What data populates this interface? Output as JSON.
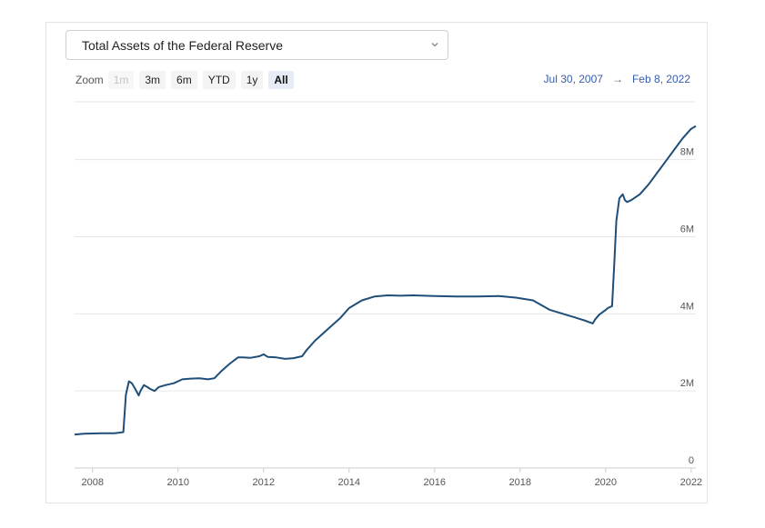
{
  "selector": {
    "label": "Total Assets of the Federal Reserve",
    "icon": "chevron-down-icon"
  },
  "zoom": {
    "label": "Zoom",
    "buttons": [
      {
        "label": "1m",
        "state": "disabled"
      },
      {
        "label": "3m",
        "state": "normal"
      },
      {
        "label": "6m",
        "state": "normal"
      },
      {
        "label": "YTD",
        "state": "normal"
      },
      {
        "label": "1y",
        "state": "normal"
      },
      {
        "label": "All",
        "state": "active"
      }
    ]
  },
  "range": {
    "from": "Jul 30, 2007",
    "arrow": "→",
    "to": "Feb 8, 2022"
  },
  "colors": {
    "line": "#1f4e79",
    "grid": "#e6e6e6",
    "range_text": "#335cad"
  },
  "chart_data": {
    "type": "line",
    "title": "",
    "xlabel": "",
    "ylabel": "",
    "x_ticks": [
      "2008",
      "2010",
      "2012",
      "2014",
      "2016",
      "2018",
      "2020",
      "2022"
    ],
    "y_ticks": [
      "0",
      "2M",
      "4M",
      "6M",
      "8M"
    ],
    "xlim": [
      2007.58,
      2022.11
    ],
    "ylim": [
      0,
      9.5
    ],
    "y_unit": "millions",
    "grid": true,
    "legend": "none",
    "series": [
      {
        "x": [
          2007.58,
          2007.8,
          2008.2,
          2008.5,
          2008.72,
          2008.78,
          2008.85,
          2008.92,
          2009.0,
          2009.08,
          2009.12,
          2009.2,
          2009.28,
          2009.35,
          2009.45,
          2009.55,
          2009.7,
          2009.9,
          2010.1,
          2010.3,
          2010.5,
          2010.7,
          2010.85,
          2011.0,
          2011.2,
          2011.4,
          2011.5,
          2011.7,
          2011.9,
          2012.0,
          2012.1,
          2012.3,
          2012.5,
          2012.7,
          2012.9,
          2013.0,
          2013.2,
          2013.5,
          2013.8,
          2014.0,
          2014.3,
          2014.6,
          2014.9,
          2015.2,
          2015.5,
          2016.0,
          2016.5,
          2017.0,
          2017.5,
          2017.9,
          2018.3,
          2018.7,
          2019.0,
          2019.3,
          2019.5,
          2019.7,
          2019.75,
          2019.85,
          2020.0,
          2020.05,
          2020.15,
          2020.2,
          2020.25,
          2020.32,
          2020.4,
          2020.45,
          2020.5,
          2020.6,
          2020.8,
          2021.0,
          2021.2,
          2021.4,
          2021.6,
          2021.8,
          2022.0,
          2022.11
        ],
        "y": [
          0.87,
          0.89,
          0.9,
          0.9,
          0.93,
          1.9,
          2.25,
          2.2,
          2.05,
          1.88,
          2.0,
          2.15,
          2.1,
          2.05,
          2.0,
          2.1,
          2.15,
          2.2,
          2.3,
          2.32,
          2.33,
          2.3,
          2.33,
          2.5,
          2.7,
          2.87,
          2.87,
          2.86,
          2.9,
          2.95,
          2.88,
          2.87,
          2.83,
          2.85,
          2.9,
          3.05,
          3.3,
          3.6,
          3.9,
          4.15,
          4.35,
          4.45,
          4.48,
          4.47,
          4.48,
          4.46,
          4.45,
          4.45,
          4.46,
          4.42,
          4.35,
          4.1,
          4.0,
          3.9,
          3.83,
          3.75,
          3.85,
          3.98,
          4.1,
          4.15,
          4.2,
          5.25,
          6.42,
          7.0,
          7.1,
          6.95,
          6.9,
          6.95,
          7.1,
          7.35,
          7.65,
          7.95,
          8.25,
          8.55,
          8.8,
          8.87
        ]
      }
    ]
  }
}
